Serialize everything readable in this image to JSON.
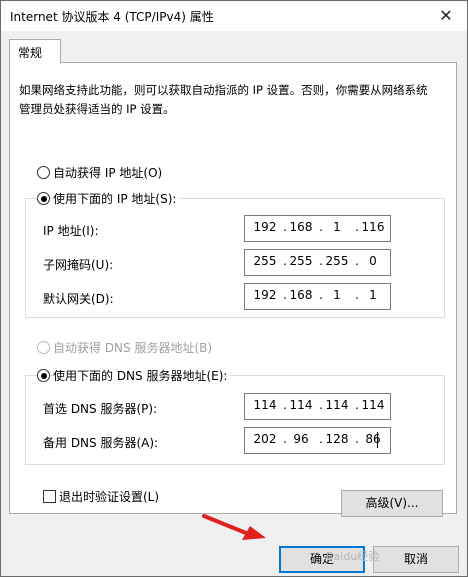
{
  "window": {
    "title": "Internet 协议版本 4 (TCP/IPv4) 属性",
    "close_symbol": "✕"
  },
  "tabs": [
    {
      "label": "常规"
    }
  ],
  "description": "如果网络支持此功能，则可以获取自动指派的 IP 设置。否则，你需要从网络系统管理员处获得适当的 IP 设置。",
  "ip_section": {
    "auto_label": "自动获得 IP 地址(O)",
    "manual_label": "使用下面的 IP 地址(S):",
    "selected": "manual",
    "fields": [
      {
        "label": "IP 地址(I):",
        "octets": [
          "192",
          "168",
          "1",
          "116"
        ]
      },
      {
        "label": "子网掩码(U):",
        "octets": [
          "255",
          "255",
          "255",
          "0"
        ]
      },
      {
        "label": "默认网关(D):",
        "octets": [
          "192",
          "168",
          "1",
          "1"
        ]
      }
    ]
  },
  "dns_section": {
    "auto_label": "自动获得 DNS 服务器地址(B)",
    "manual_label": "使用下面的 DNS 服务器地址(E):",
    "selected": "manual",
    "fields": [
      {
        "label": "首选 DNS 服务器(P):",
        "octets": [
          "114",
          "114",
          "114",
          "114"
        ]
      },
      {
        "label": "备用 DNS 服务器(A):",
        "octets": [
          "202",
          "96",
          "128",
          "86"
        ]
      }
    ]
  },
  "validate_checkbox": {
    "label": "退出时验证设置(L)",
    "checked": false
  },
  "buttons": {
    "advanced": "高级(V)...",
    "ok": "确定",
    "cancel": "取消"
  },
  "colors": {
    "accent": "#0078d7",
    "annotation_arrow": "#e0201e"
  },
  "watermark": "Baidu经验"
}
